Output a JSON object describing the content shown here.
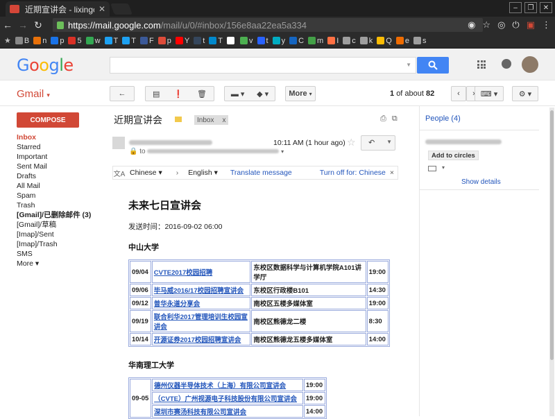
{
  "browser": {
    "tab_title": "近期宣讲会 - lixingcor",
    "url_host": "https://mail.google.com",
    "url_path": "/mail/u/0/#inbox/156e8aa22ea5a334",
    "bookmarks": [
      {
        "label": "B",
        "color": "#888888"
      },
      {
        "label": "n",
        "color": "#e8710a"
      },
      {
        "label": "p",
        "color": "#1a73e8"
      },
      {
        "label": "5",
        "color": "#d93025"
      },
      {
        "label": "w",
        "color": "#34a853"
      },
      {
        "label": "T",
        "color": "#1da1f2"
      },
      {
        "label": "T",
        "color": "#1da1f2"
      },
      {
        "label": "F",
        "color": "#3b5998"
      },
      {
        "label": "p",
        "color": "#dd4b39"
      },
      {
        "label": "Y",
        "color": "#ff0000"
      },
      {
        "label": "t",
        "color": "#35465c"
      },
      {
        "label": "T",
        "color": "#0088cc"
      },
      {
        "label": "",
        "color": "#ffffff"
      },
      {
        "label": "v",
        "color": "#4caf50"
      },
      {
        "label": "t",
        "color": "#2962ff"
      },
      {
        "label": "y",
        "color": "#00acc1"
      },
      {
        "label": "C",
        "color": "#1565c0"
      },
      {
        "label": "m",
        "color": "#43a047"
      },
      {
        "label": "I",
        "color": "#ff7043"
      },
      {
        "label": "c",
        "color": "#9e9e9e"
      },
      {
        "label": "k",
        "color": "#9e9e9e"
      },
      {
        "label": "Q",
        "color": "#fbbc05"
      },
      {
        "label": "e",
        "color": "#ef6c00"
      },
      {
        "label": "s",
        "color": "#9e9e9e"
      }
    ]
  },
  "header": {
    "logo_letters": [
      "G",
      "o",
      "o",
      "g",
      "l",
      "e"
    ]
  },
  "gmail": {
    "label": "Gmail",
    "toolbar": {
      "more_label": "More"
    },
    "pager": {
      "range": "1",
      "of_about": "of about",
      "total": "82"
    }
  },
  "sidebar": {
    "compose_label": "COMPOSE",
    "items": [
      {
        "label": "Inbox",
        "style": "active"
      },
      {
        "label": "Starred",
        "style": ""
      },
      {
        "label": "Important",
        "style": ""
      },
      {
        "label": "Sent Mail",
        "style": ""
      },
      {
        "label": "Drafts",
        "style": ""
      },
      {
        "label": "All Mail",
        "style": ""
      },
      {
        "label": "Spam",
        "style": ""
      },
      {
        "label": "Trash",
        "style": ""
      },
      {
        "label": "[Gmail]/已删除邮件 (3)",
        "style": "bold"
      },
      {
        "label": "[Gmail]/草稿",
        "style": ""
      },
      {
        "label": "[Imap]/Sent",
        "style": ""
      },
      {
        "label": "[Imap]/Trash",
        "style": ""
      },
      {
        "label": "SMS",
        "style": ""
      },
      {
        "label": "More ▾",
        "style": ""
      }
    ]
  },
  "message": {
    "subject": "近期宣讲会",
    "inbox_chip": "Inbox",
    "chip_close": "x",
    "time": "10:11 AM (1 hour ago)",
    "to_prefix": "to",
    "translate": {
      "from_lang": "Chinese ▾",
      "arrow": "›",
      "to_lang": "English ▾",
      "translate_link": "Translate message",
      "turn_off": "Turn off for: Chinese",
      "close": "×"
    }
  },
  "email": {
    "title": "未来七日宣讲会",
    "sent_time": "发送时间：2016-09-02 06:00",
    "sections": [
      {
        "university": "中山大学",
        "rows": [
          {
            "date": "09/04",
            "event": "CVTE2017校园招聘",
            "location": "东校区数据科学与计算机学院A101讲学厅",
            "time": "19:00"
          },
          {
            "date": "09/06",
            "event": "毕马威2016/17校园招聘宣讲会",
            "location": "东校区行政楼B101",
            "time": "14:30"
          },
          {
            "date": "09/12",
            "event": "普华永道分享会",
            "location": "南校区五楼多媒体室",
            "time": "19:00"
          },
          {
            "date": "09/19",
            "event": "联合利华2017管理培训生校园宣讲会",
            "location": "南校区熊德龙二楼",
            "time": "8:30"
          },
          {
            "date": "10/14",
            "event": "开源证券2017校园招聘宣讲会",
            "location": "南校区熊德龙五楼多媒体室",
            "time": "14:00"
          }
        ]
      },
      {
        "university": "华南理工大学",
        "date": "09-05",
        "rows": [
          {
            "event": "德州仪器半导体技术（上海）有限公司宣讲会",
            "time": "19:00"
          },
          {
            "event": "（CVTE）广州视源电子科技股份有限公司宣讲会",
            "time": "19:00"
          },
          {
            "event": "深圳市赛汤科技有限公司宣讲会",
            "time": "14:00"
          }
        ]
      }
    ]
  },
  "right_panel": {
    "people": "People (4)",
    "add_circles": "Add to circles",
    "show_details": "Show details"
  }
}
